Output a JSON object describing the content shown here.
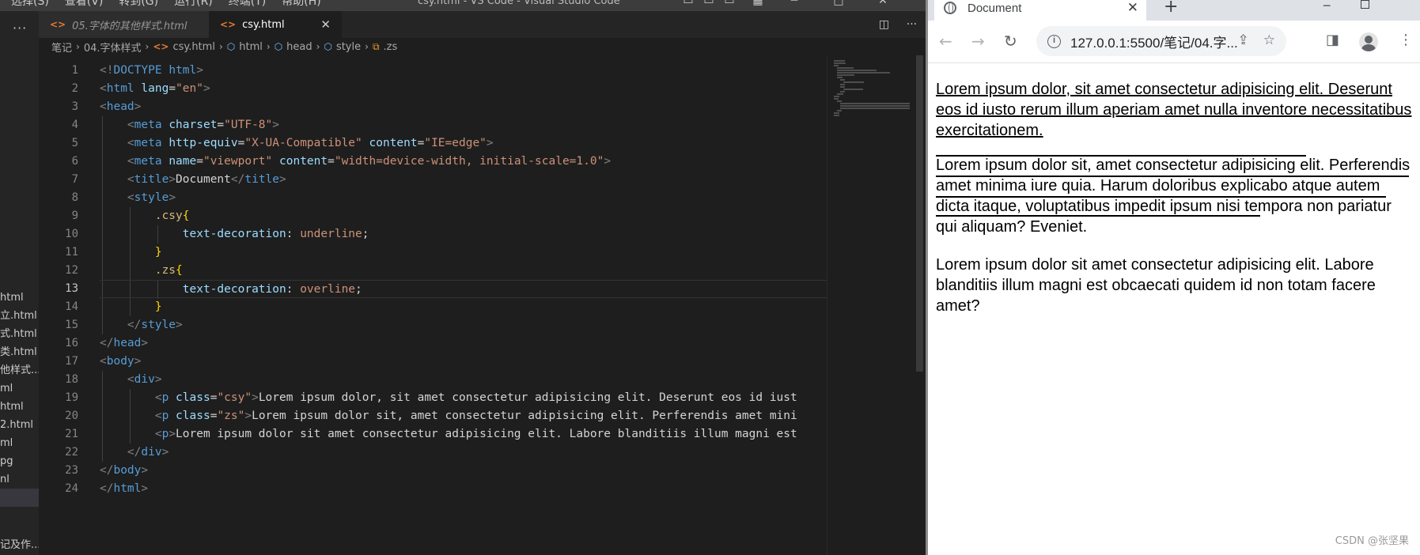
{
  "vscode": {
    "menus": [
      "选择(S)",
      "查看(V)",
      "转到(G)",
      "运行(R)",
      "终端(T)",
      "帮助(H)"
    ],
    "window_title": "csy.html - VS Code - Visual Studio Code",
    "explorer_files": [
      "html",
      "立.html",
      "式.html",
      "类.html",
      "他样式...",
      "ml",
      "html",
      "2.html",
      "ml",
      "pg",
      "nl",
      ""
    ],
    "explorer_footer": "记及作...",
    "tabs": [
      {
        "label": "05.字体的其他样式.html"
      },
      {
        "label": "csy.html",
        "close": "✕"
      }
    ],
    "breadcrumb": [
      "笔记",
      "04.字体样式",
      "csy.html",
      "html",
      "head",
      "style",
      ".zs"
    ],
    "line_numbers": [
      "1",
      "2",
      "3",
      "4",
      "5",
      "6",
      "7",
      "8",
      "9",
      "10",
      "11",
      "12",
      "13",
      "14",
      "15",
      "16",
      "17",
      "18",
      "19",
      "20",
      "21",
      "22",
      "23",
      "24"
    ],
    "current_line": 13,
    "code_lines": {
      "l1": "<!DOCTYPE html>",
      "l2": "<html lang=\"en\">",
      "l3": "<head>",
      "l4": "<meta charset=\"UTF-8\">",
      "l5": "<meta http-equiv=\"X-UA-Compatible\" content=\"IE=edge\">",
      "l6": "<meta name=\"viewport\" content=\"width=device-width, initial-scale=1.0\">",
      "l7": "<title>Document</title>",
      "l8": "<style>",
      "l9": ".csy{",
      "l10": "text-decoration: underline;",
      "l11": "}",
      "l12": ".zs{",
      "l13": "text-decoration: overline;",
      "l14": "}",
      "l15": "</style>",
      "l16": "</head>",
      "l17": "<body>",
      "l18": "<div>",
      "l19": "<p class=\"csy\">Lorem ipsum dolor, sit amet consectetur adipisicing elit. Deserunt eos id iust",
      "l20": "<p class=\"zs\">Lorem ipsum dolor sit, amet consectetur adipisicing elit. Perferendis amet mini",
      "l21": "<p>Lorem ipsum dolor sit amet consectetur adipisicing elit. Labore blanditiis illum magni est",
      "l22": "</div>",
      "l23": "</body>",
      "l24": "</html>"
    }
  },
  "chrome": {
    "tab_title": "Document",
    "tab_close": "✕",
    "new_tab": "+",
    "url": "127.0.0.1:5500/笔记/04.字...",
    "paragraphs": {
      "p1": "Lorem ipsum dolor, sit amet consectetur adipisicing elit. Deserunt eos id iusto rerum illum aperiam amet nulla inventore necessitatibus exercitationem.",
      "p2": "Lorem ipsum dolor sit, amet consectetur adipisicing elit. Perferendis amet minima iure quia. Harum doloribus explicabo atque autem dicta itaque, voluptatibus impedit ipsum nisi tempora non pariatur qui aliquam? Eveniet.",
      "p3": "Lorem ipsum dolor sit amet consectetur adipisicing elit. Labore blanditiis illum magni est obcaecati quidem id non totam facere amet?"
    },
    "watermark": "CSDN @张坚果"
  }
}
